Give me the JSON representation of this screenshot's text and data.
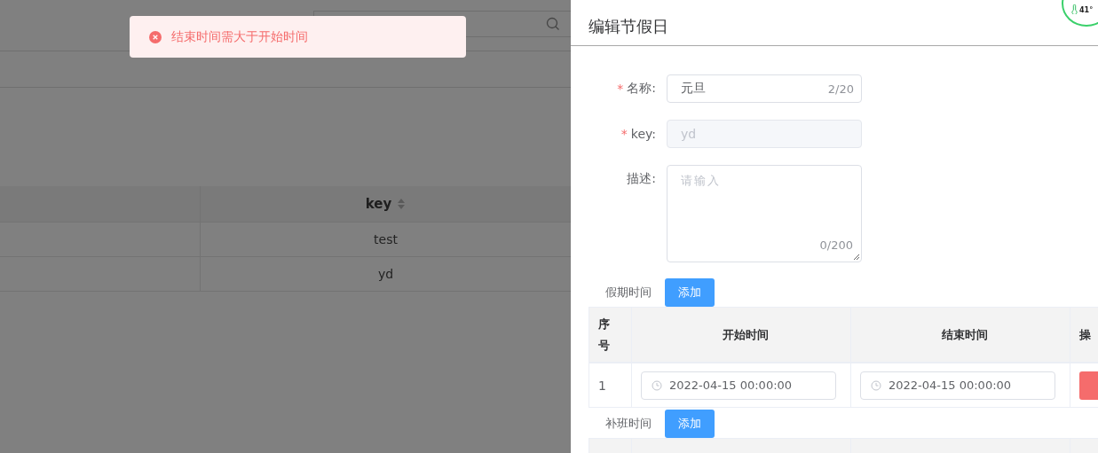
{
  "background": {
    "table": {
      "columns": [
        {
          "label": "key",
          "sortable": true
        }
      ],
      "rows": [
        {
          "key": "test"
        },
        {
          "key": "yd"
        }
      ]
    }
  },
  "toast": {
    "message": "结束时间需大于开始时间"
  },
  "widget": {
    "temperature": "41°"
  },
  "drawer": {
    "title": "编辑节假日",
    "fields": [
      {
        "kind": "input",
        "required_mark": "*",
        "label": "名称:",
        "value": "元旦",
        "counter": "2/20",
        "disabled": false
      },
      {
        "kind": "input",
        "required_mark": "*",
        "label": "key:",
        "value": "yd",
        "disabled": true
      },
      {
        "kind": "textarea",
        "label": "描述:",
        "placeholder": "请输入",
        "counter": "0/200"
      }
    ],
    "sections": [
      {
        "label": "假期时间",
        "button": "添加",
        "table": {
          "columns": [
            "序号",
            "开始时间",
            "结束时间",
            "操"
          ],
          "rows": [
            {
              "index": "1",
              "start": "2022-04-15 00:00:00",
              "end": "2022-04-15 00:00:00"
            }
          ]
        }
      },
      {
        "label": "补班时间",
        "button": "添加"
      }
    ]
  }
}
